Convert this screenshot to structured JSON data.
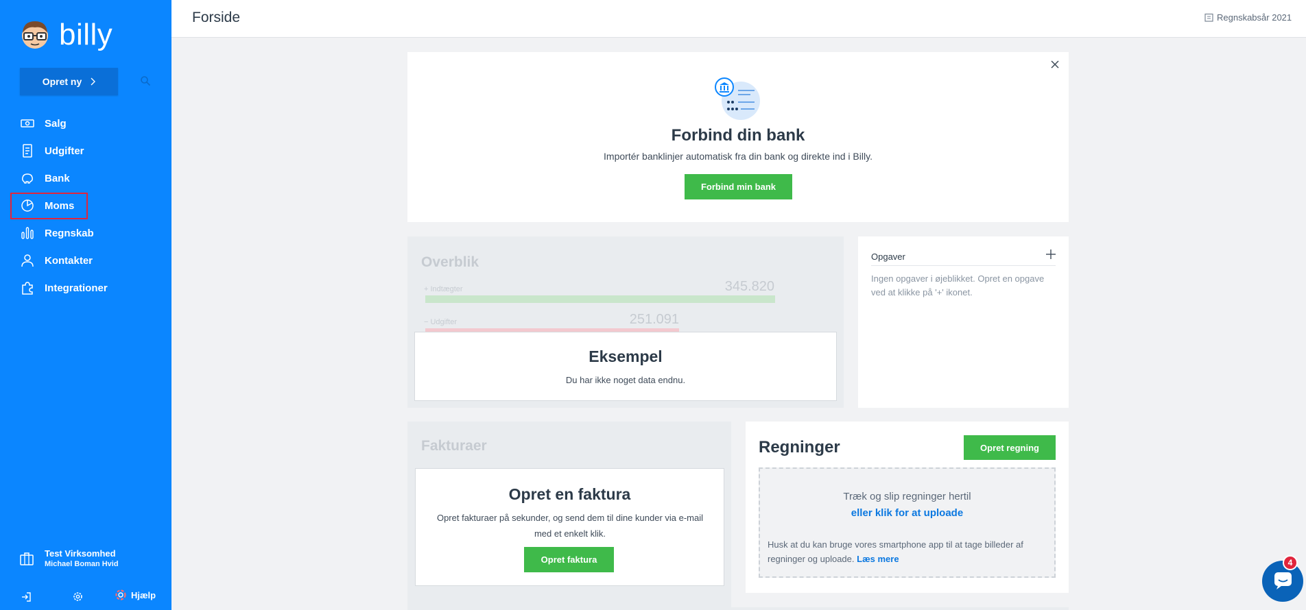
{
  "sidebar": {
    "logo_text": "billy",
    "create_label": "Opret ny",
    "nav": [
      {
        "label": "Salg",
        "icon": "money-icon"
      },
      {
        "label": "Udgifter",
        "icon": "receipt-icon"
      },
      {
        "label": "Bank",
        "icon": "piggy-bank-icon"
      },
      {
        "label": "Moms",
        "icon": "pie-chart-icon"
      },
      {
        "label": "Regnskab",
        "icon": "bar-chart-icon"
      },
      {
        "label": "Kontakter",
        "icon": "person-icon"
      },
      {
        "label": "Integrationer",
        "icon": "puzzle-icon"
      }
    ],
    "company_name": "Test Virksomhed",
    "company_user": "Michael Boman Hvid",
    "help_label": "Hjælp"
  },
  "header": {
    "title": "Forside",
    "fiscal_year": "Regnskabsår 2021"
  },
  "bank_card": {
    "title": "Forbind din bank",
    "subtitle": "Importér banklinjer automatisk fra din bank og direkte ind i Billy.",
    "button": "Forbind min bank"
  },
  "overview": {
    "title": "Overblik",
    "income_label": "+ Indtægter",
    "income_value": "345.820",
    "expense_label": "− Udgifter",
    "expense_value": "251.091",
    "example_title": "Eksempel",
    "example_sub": "Du har ikke noget data endnu."
  },
  "tasks": {
    "title": "Opgaver",
    "empty": "Ingen opgaver i øjeblikket. Opret en opgave ved at klikke på '+' ikonet."
  },
  "invoices": {
    "title": "Fakturaer",
    "box_title": "Opret en faktura",
    "box_sub": "Opret fakturaer på sekunder, og send dem til dine kunder via e-mail med et enkelt klik.",
    "button": "Opret faktura"
  },
  "bills": {
    "title": "Regninger",
    "button": "Opret regning",
    "drop_line1": "Træk og slip regninger hertil",
    "drop_line2": "eller klik for at uploade",
    "hint": "Husk at du kan bruge vores smartphone app til at tage billeder af regninger og uploade.",
    "hint_link": "Læs mere"
  },
  "chat": {
    "badge": "4"
  },
  "colors": {
    "sidebar": "#0b86ff",
    "accent_green": "#3fba4a",
    "link_blue": "#0b78e0",
    "highlight_red": "#e0253c"
  }
}
